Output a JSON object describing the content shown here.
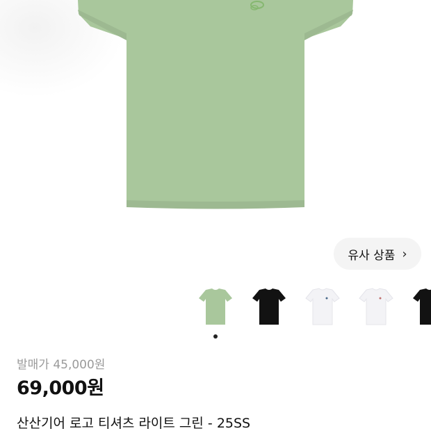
{
  "colors": {
    "shirt_green": "#a9c79c",
    "shirt_green_shadow": "#9db991",
    "logo_green": "#86b870",
    "shirt_black": "#121212",
    "shirt_white": "#f3f3f6",
    "price_gray": "#9a9a9a",
    "button_bg": "#f4f4f4"
  },
  "similar_button": {
    "label": "유사 상품",
    "icon": "chevron-right-icon"
  },
  "thumbnails": [
    {
      "variant": "light-green",
      "selected": true
    },
    {
      "variant": "black",
      "selected": false
    },
    {
      "variant": "white",
      "selected": false
    },
    {
      "variant": "white",
      "selected": false
    },
    {
      "variant": "black",
      "selected": false
    }
  ],
  "pagination": {
    "current": 1
  },
  "price": {
    "original": "발매가 45,000원",
    "current": "69,000원"
  },
  "product": {
    "title": "산산기어 로고 티셔츠 라이트 그린 - 25SS"
  }
}
